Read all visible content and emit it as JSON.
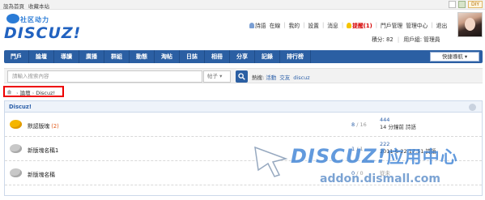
{
  "topbar": {
    "set_home": "設為首頁",
    "bookmark": "收藏本站",
    "diy": "DIY"
  },
  "header": {
    "logo_sub": "社区动力",
    "logo_main": "DISCUZ!",
    "user": "詩語",
    "status": "在線",
    "mine": "我的",
    "settings": "設置",
    "messages": "消息",
    "notice": "提醒(1)",
    "portal_manage": "門戶管理",
    "admin_center": "管理中心",
    "logout": "退出",
    "credits_label": "積分: 82",
    "group_label": "用戶組: 管理員"
  },
  "nav": {
    "items": [
      "門戶",
      "論壇",
      "導讀",
      "廣播",
      "群組",
      "動態",
      "淘帖",
      "日誌",
      "相冊",
      "分享",
      "記錄",
      "排行榜"
    ],
    "quick_nav": "快捷導航"
  },
  "search": {
    "placeholder": "請輸入搜索內容",
    "type": "帖子",
    "hot_label": "熱搜:",
    "hot_terms": [
      "活動",
      "交友",
      "discuz"
    ]
  },
  "breadcrumb": {
    "forum": "論壇",
    "current": "Discuz!"
  },
  "forum": {
    "title": "Discuz!",
    "rows": [
      {
        "name": "默認版塊",
        "today": "(2)",
        "threads": "8",
        "posts": "16",
        "last_title": "444",
        "last_info": "14 分鐘前 詩語",
        "active": true
      },
      {
        "name": "新版塊名稱1",
        "today": "",
        "threads": "1",
        "posts": "1",
        "last_title": "222",
        "last_info": "2011-6-22 17:51 詩語",
        "active": false
      },
      {
        "name": "新版塊名稱",
        "today": "",
        "threads": "0",
        "posts": "0",
        "last_title": "從未",
        "last_info": "",
        "active": false
      }
    ]
  },
  "watermark": {
    "brand": "DISCUZ!",
    "brand_cn": "应用中心",
    "url": "addon.dismall.com"
  }
}
